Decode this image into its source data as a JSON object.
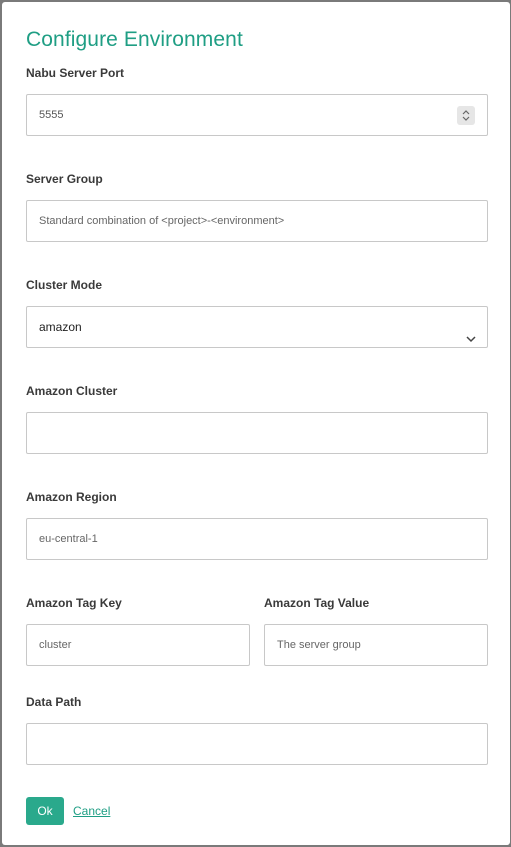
{
  "dialog": {
    "title": "Configure Environment",
    "accent_color": "#1f9e84",
    "ok_label": "Ok",
    "cancel_label": "Cancel"
  },
  "fields": {
    "server_port": {
      "label": "Nabu Server Port",
      "value": "5555"
    },
    "server_group": {
      "label": "Server Group",
      "placeholder": "Standard combination of <project>-<environment>"
    },
    "cluster_mode": {
      "label": "Cluster Mode",
      "value": "amazon"
    },
    "amazon_cluster": {
      "label": "Amazon Cluster",
      "value": ""
    },
    "amazon_region": {
      "label": "Amazon Region",
      "placeholder": "eu-central-1"
    },
    "amazon_tag_key": {
      "label": "Amazon Tag Key",
      "placeholder": "cluster"
    },
    "amazon_tag_value": {
      "label": "Amazon Tag Value",
      "placeholder": "The server group"
    },
    "data_path": {
      "label": "Data Path",
      "value": ""
    }
  },
  "icons": {
    "spinner": "up-down-stepper-icon",
    "select": "chevron-down-icon"
  }
}
